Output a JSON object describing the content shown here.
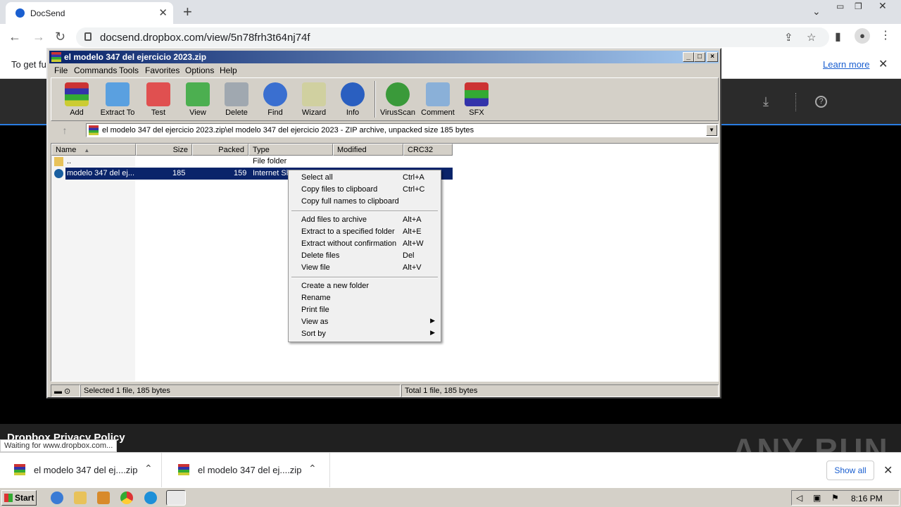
{
  "browser": {
    "tab_title": "DocSend",
    "url": "docsend.dropbox.com/view/5n78frh3t64nj74f",
    "infobar_message": "To get fu",
    "learn_more": "Learn more",
    "status_text": "Waiting for www.dropbox.com...",
    "page_footer": "Dropbox Privacy Policy",
    "watermark": "ANY RUN"
  },
  "downloads": {
    "items": [
      {
        "name": "el modelo 347 del ej....zip"
      },
      {
        "name": "el modelo 347 del ej....zip"
      }
    ],
    "show_all": "Show all"
  },
  "winrar": {
    "title": "el modelo 347 del ejercicio 2023.zip",
    "menu": [
      "File",
      "Commands",
      "Tools",
      "Favorites",
      "Options",
      "Help"
    ],
    "toolbar": [
      "Add",
      "Extract To",
      "Test",
      "View",
      "Delete",
      "Find",
      "Wizard",
      "Info",
      "VirusScan",
      "Comment",
      "SFX"
    ],
    "path": "el modelo 347 del ejercicio 2023.zip\\el modelo 347 del ejercicio 2023 - ZIP archive, unpacked size 185 bytes",
    "columns": [
      "Name",
      "Size",
      "Packed",
      "Type",
      "Modified",
      "CRC32"
    ],
    "rows": [
      {
        "name": "..",
        "size": "",
        "packed": "",
        "type": "File folder"
      },
      {
        "name": "modelo 347 del ej...",
        "size": "185",
        "packed": "159",
        "type": "Internet Sh"
      }
    ],
    "status_left": "Selected 1 file, 185 bytes",
    "status_right": "Total 1 file, 185 bytes"
  },
  "context_menu": {
    "groups": [
      [
        {
          "label": "Select all",
          "key": "Ctrl+A"
        },
        {
          "label": "Copy files to clipboard",
          "key": "Ctrl+C"
        },
        {
          "label": "Copy full names to clipboard",
          "key": ""
        }
      ],
      [
        {
          "label": "Add files to archive",
          "key": "Alt+A"
        },
        {
          "label": "Extract to a specified folder",
          "key": "Alt+E"
        },
        {
          "label": "Extract without confirmation",
          "key": "Alt+W"
        },
        {
          "label": "Delete files",
          "key": "Del"
        },
        {
          "label": "View file",
          "key": "Alt+V"
        }
      ],
      [
        {
          "label": "Create a new folder",
          "key": ""
        },
        {
          "label": "Rename",
          "key": ""
        },
        {
          "label": "Print file",
          "key": ""
        },
        {
          "label": "View as",
          "key": ""
        },
        {
          "label": "Sort by",
          "key": ""
        }
      ]
    ]
  },
  "taskbar": {
    "start": "Start",
    "clock": "8:16 PM"
  }
}
